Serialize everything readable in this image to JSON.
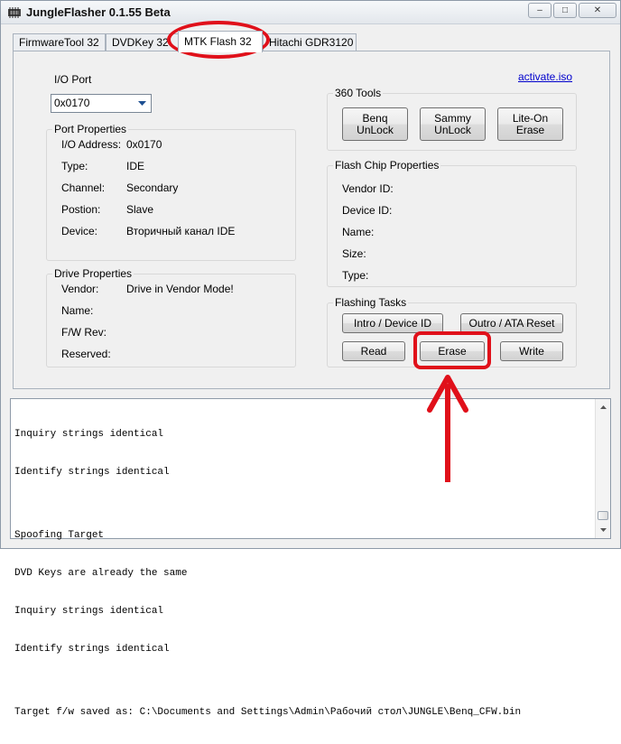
{
  "window": {
    "title": "JungleFlasher 0.1.55 Beta",
    "minimize_glyph": "–",
    "maximize_glyph": "□",
    "close_glyph": "✕"
  },
  "tabs": [
    {
      "label": "FirmwareTool 32"
    },
    {
      "label": "DVDKey 32"
    },
    {
      "label": "MTK Flash 32"
    },
    {
      "label": "Hitachi GDR3120"
    }
  ],
  "io_port": {
    "label": "I/O Port",
    "value": "0x0170"
  },
  "activate_link": "activate.iso",
  "port_properties": {
    "title": "Port Properties",
    "rows": [
      {
        "label": "I/O Address:",
        "value": "0x0170"
      },
      {
        "label": "Type:",
        "value": "IDE"
      },
      {
        "label": "Channel:",
        "value": "Secondary"
      },
      {
        "label": "Postion:",
        "value": "Slave"
      },
      {
        "label": "Device:",
        "value": "Вторичный канал IDE"
      }
    ]
  },
  "drive_properties": {
    "title": "Drive Properties",
    "rows": [
      {
        "label": "Vendor:",
        "value": "Drive in Vendor Mode!"
      },
      {
        "label": "Name:",
        "value": ""
      },
      {
        "label": "F/W Rev:",
        "value": ""
      },
      {
        "label": "Reserved:",
        "value": ""
      }
    ]
  },
  "tools_360": {
    "title": "360 Tools",
    "buttons": [
      {
        "label": "Benq\nUnLock"
      },
      {
        "label": "Sammy\nUnLock"
      },
      {
        "label": "Lite-On Erase"
      }
    ]
  },
  "flash_chip": {
    "title": "Flash Chip Properties",
    "rows": [
      {
        "label": "Vendor ID:"
      },
      {
        "label": "Device ID:"
      },
      {
        "label": "Name:"
      },
      {
        "label": "Size:"
      },
      {
        "label": "Type:"
      }
    ]
  },
  "flashing_tasks": {
    "title": "Flashing Tasks",
    "intro": "Intro / Device ID",
    "outro": "Outro / ATA Reset",
    "read": "Read",
    "erase": "Erase",
    "write": "Write"
  },
  "log": {
    "lines": [
      "Inquiry strings identical",
      "Identify strings identical",
      "",
      "Spoofing Target",
      "DVD Keys are already the same",
      "Inquiry strings identical",
      "Identify strings identical",
      "",
      "Target f/w saved as: C:\\Documents and Settings\\Admin\\Рабочий стол\\JUNGLE\\Benq_CFW.bin"
    ]
  },
  "colors": {
    "annotation": "#e0101a",
    "link": "#0000cc"
  }
}
